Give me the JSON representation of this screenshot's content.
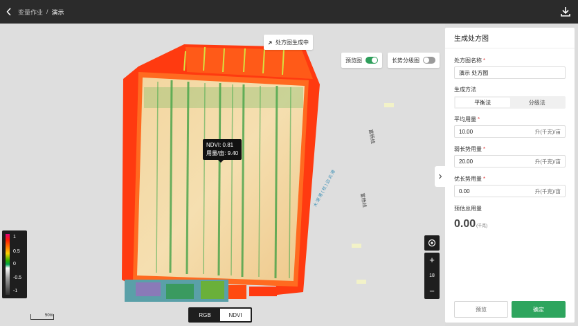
{
  "header": {
    "back_icon": "chevron-left-icon",
    "breadcrumb_parent": "变量作业",
    "breadcrumb_separator": "/",
    "breadcrumb_current": "演示",
    "download_icon": "download-icon"
  },
  "map": {
    "status_text": "处方图生成中",
    "preview_toggle_label": "预览图",
    "preview_toggle_on": true,
    "growth_toggle_label": "长势分级图",
    "growth_toggle_on": false,
    "tooltip_ndvi": "NDVI: 0.81",
    "tooltip_dose": "用量/亩: 9.40",
    "road_label_1": "富杨线",
    "road_label_2": "富杨线",
    "river_label": "大 湖 港 ( 柱 ) 边 北 港",
    "legend_labels": [
      "1",
      "0.5",
      "0",
      "-0.5",
      "-1"
    ],
    "scale_label": "50m",
    "zoom_in": "+",
    "zoom_level": "18",
    "zoom_out": "−",
    "layer_rgb": "RGB",
    "layer_ndvi": "NDVI",
    "collapse_icon": "chevron-right-icon",
    "colors": {
      "accent": "#2ea55e",
      "toolbar": "#1e1e1e"
    }
  },
  "panel": {
    "title": "生成处方图",
    "name_label": "处方图名称",
    "name_value": "演示 处方图",
    "method_label": "生成方法",
    "method_options": [
      "平衡法",
      "分级法"
    ],
    "method_selected": "平衡法",
    "avg_label": "平均用量",
    "avg_value": "10.00",
    "weak_label": "弱长势用量",
    "weak_value": "20.00",
    "strong_label": "优长势用量",
    "strong_value": "0.00",
    "unit": "升(千克)/亩",
    "total_label": "预估总用量",
    "total_value": "0.00",
    "total_unit": "(千克)",
    "required_mark": "*",
    "preview_button": "预览",
    "confirm_button": "确定"
  }
}
